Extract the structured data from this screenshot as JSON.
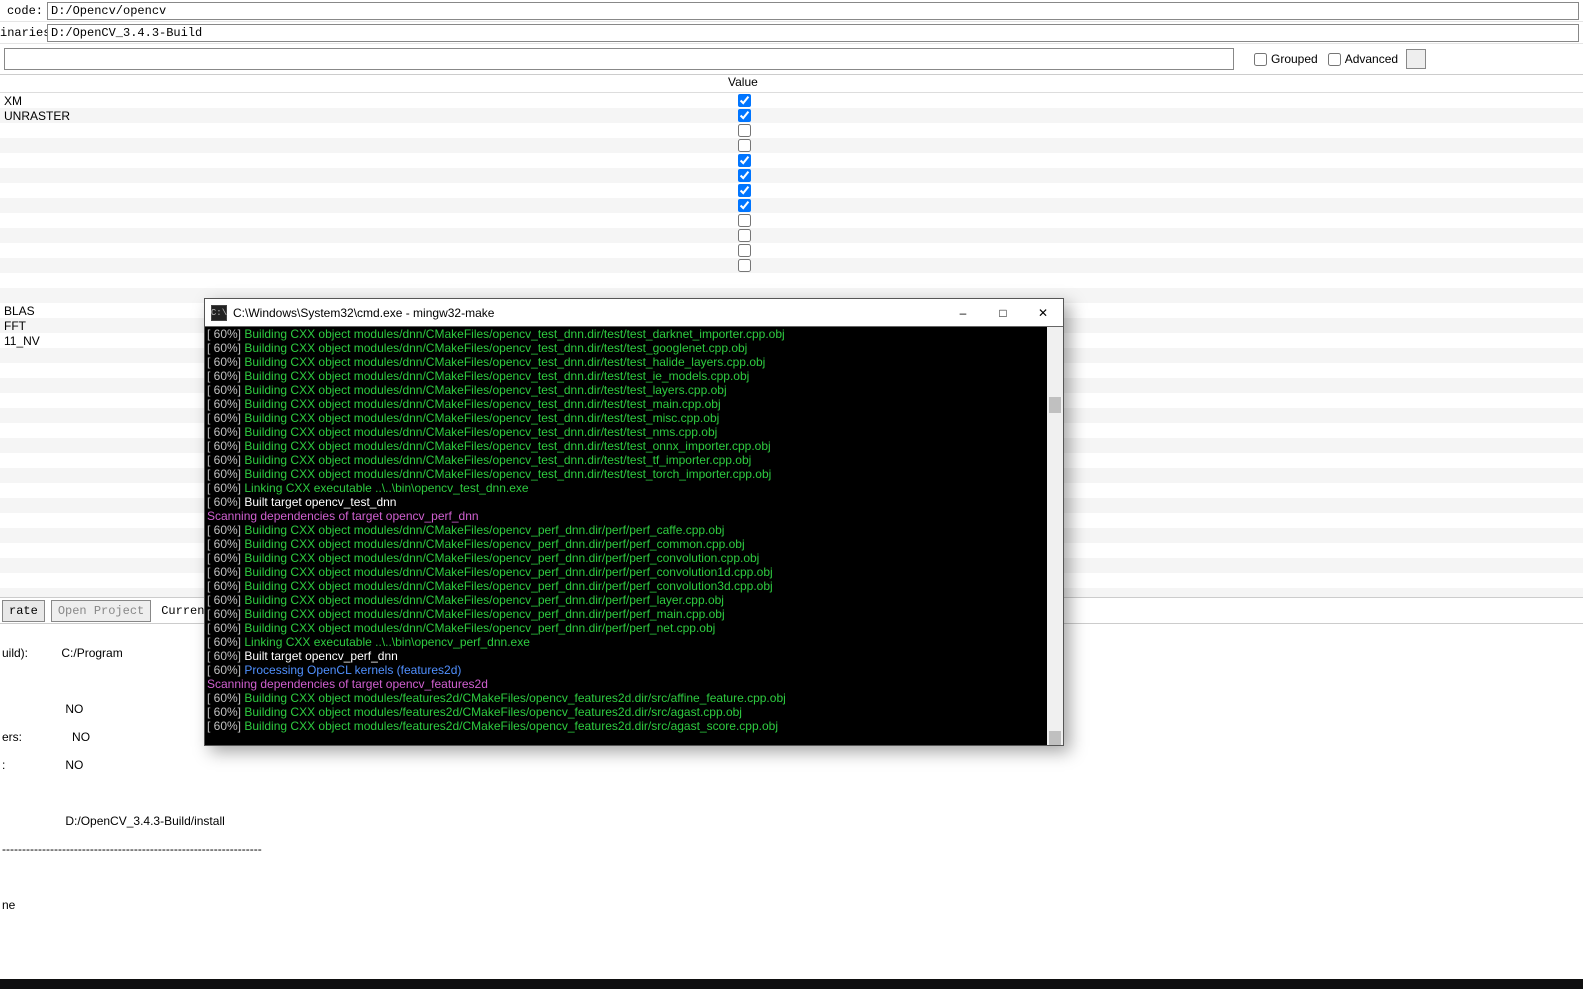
{
  "paths": {
    "code_label": "code:",
    "code_value": "D:/Opencv/opencv",
    "binaries_label": "inaries:",
    "binaries_value": "D:/OpenCV_3.4.3-Build"
  },
  "filter": {
    "grouped_label": "Grouped",
    "advanced_label": "Advanced"
  },
  "table": {
    "name_header": "",
    "value_header": "Value",
    "rows": [
      {
        "name": "XM",
        "checked": true
      },
      {
        "name": "UNRASTER",
        "checked": true
      },
      {
        "name": "",
        "checked": false
      },
      {
        "name": "",
        "checked": false
      },
      {
        "name": "",
        "checked": true
      },
      {
        "name": "",
        "checked": true
      },
      {
        "name": "",
        "checked": true
      },
      {
        "name": "",
        "checked": true
      },
      {
        "name": "",
        "checked": false
      },
      {
        "name": "",
        "checked": false
      },
      {
        "name": "",
        "checked": false
      },
      {
        "name": "",
        "checked": false
      },
      {
        "name": "",
        "checked": null
      },
      {
        "name": "",
        "checked": null
      },
      {
        "name": "BLAS",
        "checked": null
      },
      {
        "name": "FFT",
        "checked": null
      },
      {
        "name": "11_NV",
        "checked": null
      }
    ]
  },
  "btnbar": {
    "generate": "rate",
    "open_project": "Open Project",
    "current_generator": "Current Generator"
  },
  "output": {
    "l1": "uild):",
    "l1b": "C:/Program",
    "l2": "",
    "l3a": "NO",
    "l4": "ers:",
    "l4b": "NO",
    "l5": ":",
    "l5b": "NO",
    "l6": "",
    "l7": "D:/OpenCV_3.4.3-Build/install",
    "l8": "-----------------------------------------------------------------",
    "l9": "",
    "l10": "ne"
  },
  "cmd": {
    "title": "C:\\Windows\\System32\\cmd.exe - mingw32-make",
    "icon": "C:\\",
    "lines": [
      {
        "pct": "[ 60%]",
        "cls": "c-green",
        "text": " Building CXX object modules/dnn/CMakeFiles/opencv_test_dnn.dir/test/test_darknet_importer.cpp.obj"
      },
      {
        "pct": "[ 60%]",
        "cls": "c-green",
        "text": " Building CXX object modules/dnn/CMakeFiles/opencv_test_dnn.dir/test/test_googlenet.cpp.obj"
      },
      {
        "pct": "[ 60%]",
        "cls": "c-green",
        "text": " Building CXX object modules/dnn/CMakeFiles/opencv_test_dnn.dir/test/test_halide_layers.cpp.obj"
      },
      {
        "pct": "[ 60%]",
        "cls": "c-green",
        "text": " Building CXX object modules/dnn/CMakeFiles/opencv_test_dnn.dir/test/test_ie_models.cpp.obj"
      },
      {
        "pct": "[ 60%]",
        "cls": "c-green",
        "text": " Building CXX object modules/dnn/CMakeFiles/opencv_test_dnn.dir/test/test_layers.cpp.obj"
      },
      {
        "pct": "[ 60%]",
        "cls": "c-green",
        "text": " Building CXX object modules/dnn/CMakeFiles/opencv_test_dnn.dir/test/test_main.cpp.obj"
      },
      {
        "pct": "[ 60%]",
        "cls": "c-green",
        "text": " Building CXX object modules/dnn/CMakeFiles/opencv_test_dnn.dir/test/test_misc.cpp.obj"
      },
      {
        "pct": "[ 60%]",
        "cls": "c-green",
        "text": " Building CXX object modules/dnn/CMakeFiles/opencv_test_dnn.dir/test/test_nms.cpp.obj"
      },
      {
        "pct": "[ 60%]",
        "cls": "c-green",
        "text": " Building CXX object modules/dnn/CMakeFiles/opencv_test_dnn.dir/test/test_onnx_importer.cpp.obj"
      },
      {
        "pct": "[ 60%]",
        "cls": "c-green",
        "text": " Building CXX object modules/dnn/CMakeFiles/opencv_test_dnn.dir/test/test_tf_importer.cpp.obj"
      },
      {
        "pct": "[ 60%]",
        "cls": "c-green",
        "text": " Building CXX object modules/dnn/CMakeFiles/opencv_test_dnn.dir/test/test_torch_importer.cpp.obj"
      },
      {
        "pct": "[ 60%]",
        "cls": "c-green",
        "text": " Linking CXX executable ..\\..\\bin\\opencv_test_dnn.exe"
      },
      {
        "pct": "[ 60%]",
        "cls": "c-white",
        "text": " Built target opencv_test_dnn"
      },
      {
        "pct": "",
        "cls": "c-magenta",
        "text": "Scanning dependencies of target opencv_perf_dnn"
      },
      {
        "pct": "[ 60%]",
        "cls": "c-green",
        "text": " Building CXX object modules/dnn/CMakeFiles/opencv_perf_dnn.dir/perf/perf_caffe.cpp.obj"
      },
      {
        "pct": "[ 60%]",
        "cls": "c-green",
        "text": " Building CXX object modules/dnn/CMakeFiles/opencv_perf_dnn.dir/perf/perf_common.cpp.obj"
      },
      {
        "pct": "[ 60%]",
        "cls": "c-green",
        "text": " Building CXX object modules/dnn/CMakeFiles/opencv_perf_dnn.dir/perf/perf_convolution.cpp.obj"
      },
      {
        "pct": "[ 60%]",
        "cls": "c-green",
        "text": " Building CXX object modules/dnn/CMakeFiles/opencv_perf_dnn.dir/perf/perf_convolution1d.cpp.obj"
      },
      {
        "pct": "[ 60%]",
        "cls": "c-green",
        "text": " Building CXX object modules/dnn/CMakeFiles/opencv_perf_dnn.dir/perf/perf_convolution3d.cpp.obj"
      },
      {
        "pct": "[ 60%]",
        "cls": "c-green",
        "text": " Building CXX object modules/dnn/CMakeFiles/opencv_perf_dnn.dir/perf/perf_layer.cpp.obj"
      },
      {
        "pct": "[ 60%]",
        "cls": "c-green",
        "text": " Building CXX object modules/dnn/CMakeFiles/opencv_perf_dnn.dir/perf/perf_main.cpp.obj"
      },
      {
        "pct": "[ 60%]",
        "cls": "c-green",
        "text": " Building CXX object modules/dnn/CMakeFiles/opencv_perf_dnn.dir/perf/perf_net.cpp.obj"
      },
      {
        "pct": "[ 60%]",
        "cls": "c-green",
        "text": " Linking CXX executable ..\\..\\bin\\opencv_perf_dnn.exe"
      },
      {
        "pct": "[ 60%]",
        "cls": "c-white",
        "text": " Built target opencv_perf_dnn"
      },
      {
        "pct": "[ 60%]",
        "cls": "c-blue",
        "text": " Processing OpenCL kernels (features2d)"
      },
      {
        "pct": "",
        "cls": "c-magenta",
        "text": "Scanning dependencies of target opencv_features2d"
      },
      {
        "pct": "[ 60%]",
        "cls": "c-green",
        "text": " Building CXX object modules/features2d/CMakeFiles/opencv_features2d.dir/src/affine_feature.cpp.obj"
      },
      {
        "pct": "[ 60%]",
        "cls": "c-green",
        "text": " Building CXX object modules/features2d/CMakeFiles/opencv_features2d.dir/src/agast.cpp.obj"
      },
      {
        "pct": "[ 60%]",
        "cls": "c-green",
        "text": " Building CXX object modules/features2d/CMakeFiles/opencv_features2d.dir/src/agast_score.cpp.obj"
      }
    ]
  }
}
